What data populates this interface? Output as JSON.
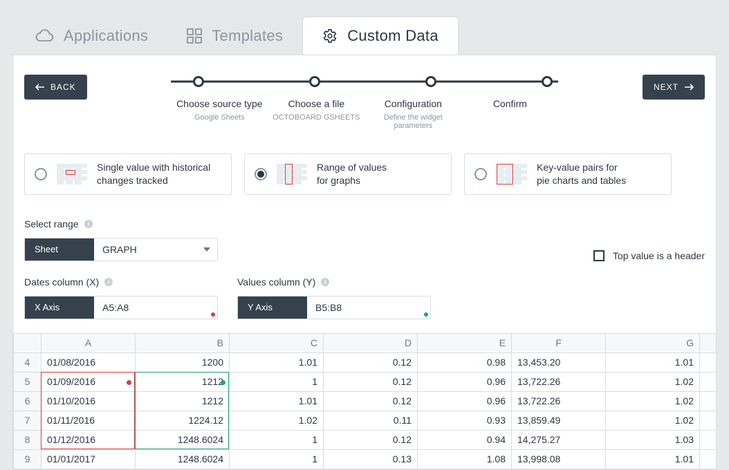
{
  "tabs": [
    {
      "id": "applications",
      "label": "Applications"
    },
    {
      "id": "templates",
      "label": "Templates"
    },
    {
      "id": "custom-data",
      "label": "Custom Data"
    }
  ],
  "active_tab": "custom-data",
  "nav": {
    "back": "BACK",
    "next": "NEXT"
  },
  "steps": [
    {
      "title": "Choose source type",
      "sub": "Google Sheets"
    },
    {
      "title": "Choose a file",
      "sub": "OCTOBOARD GSHEETS"
    },
    {
      "title": "Configuration",
      "sub": "Define the widget parameters"
    },
    {
      "title": "Confirm",
      "sub": ""
    }
  ],
  "type_options": [
    {
      "id": "single",
      "line1": "Single value with historical",
      "line2": "changes tracked",
      "selected": false
    },
    {
      "id": "range",
      "line1": "Range of values",
      "line2": "for graphs",
      "selected": true
    },
    {
      "id": "kv",
      "line1": "Key-value pairs for",
      "line2": "pie charts and tables",
      "selected": false
    }
  ],
  "form": {
    "select_range_label": "Select range",
    "sheet_tag": "Sheet",
    "sheet_value": "GRAPH",
    "header_checkbox_label": "Top value is a header",
    "header_checked": false,
    "x": {
      "label": "Dates column (X)",
      "tag": "X Axis",
      "value": "A5:A8"
    },
    "y": {
      "label": "Values column (Y)",
      "tag": "Y Axis",
      "value": "B5:B8"
    }
  },
  "sheet": {
    "columns": [
      "A",
      "B",
      "C",
      "D",
      "E",
      "F",
      "G"
    ],
    "rows": [
      {
        "n": 4,
        "A": "01/08/2016",
        "B": "1200",
        "C": "1.01",
        "D": "0.12",
        "E": "0.98",
        "F": "13,453.20",
        "G": "1.01"
      },
      {
        "n": 5,
        "A": "01/09/2016",
        "B": "1212",
        "C": "1",
        "D": "0.12",
        "E": "0.96",
        "F": "13,722.26",
        "G": "1.02"
      },
      {
        "n": 6,
        "A": "01/10/2016",
        "B": "1212",
        "C": "1.01",
        "D": "0.12",
        "E": "0.96",
        "F": "13,722.26",
        "G": "1.02"
      },
      {
        "n": 7,
        "A": "01/11/2016",
        "B": "1224.12",
        "C": "1.02",
        "D": "0.11",
        "E": "0.93",
        "F": "13,859.49",
        "G": "1.02"
      },
      {
        "n": 8,
        "A": "01/12/2016",
        "B": "1248.6024",
        "C": "1",
        "D": "0.12",
        "E": "0.94",
        "F": "14,275.27",
        "G": "1.03"
      },
      {
        "n": 9,
        "A": "01/01/2017",
        "B": "1248.6024",
        "C": "1",
        "D": "0.13",
        "E": "1.08",
        "F": "13,998.08",
        "G": "1.01"
      }
    ],
    "x_selection": {
      "col": "A",
      "from_row": 5,
      "to_row": 8
    },
    "y_selection": {
      "col": "B",
      "from_row": 5,
      "to_row": 8
    }
  }
}
